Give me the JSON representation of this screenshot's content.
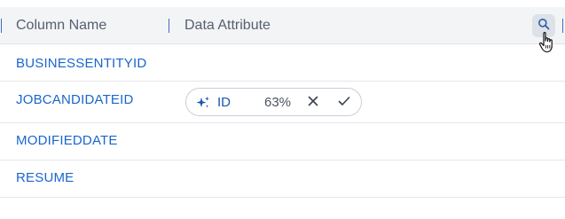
{
  "header": {
    "columns": [
      {
        "label": "Column Name"
      },
      {
        "label": "Data Attribute"
      }
    ],
    "search_icon": "search-icon"
  },
  "rows": [
    {
      "name": "BUSINESSENTITYID"
    },
    {
      "name": "JOBCANDIDATEID",
      "suggestion": {
        "icon": "sparkle-icon",
        "label": "ID",
        "confidence": "63%",
        "reject_icon": "close-icon",
        "accept_icon": "check-icon"
      }
    },
    {
      "name": "MODIFIEDDATE"
    },
    {
      "name": "RESUME"
    }
  ],
  "colors": {
    "link": "#1a66cc",
    "header_bg": "#f3f4f6",
    "accent": "#2c6fd1"
  }
}
